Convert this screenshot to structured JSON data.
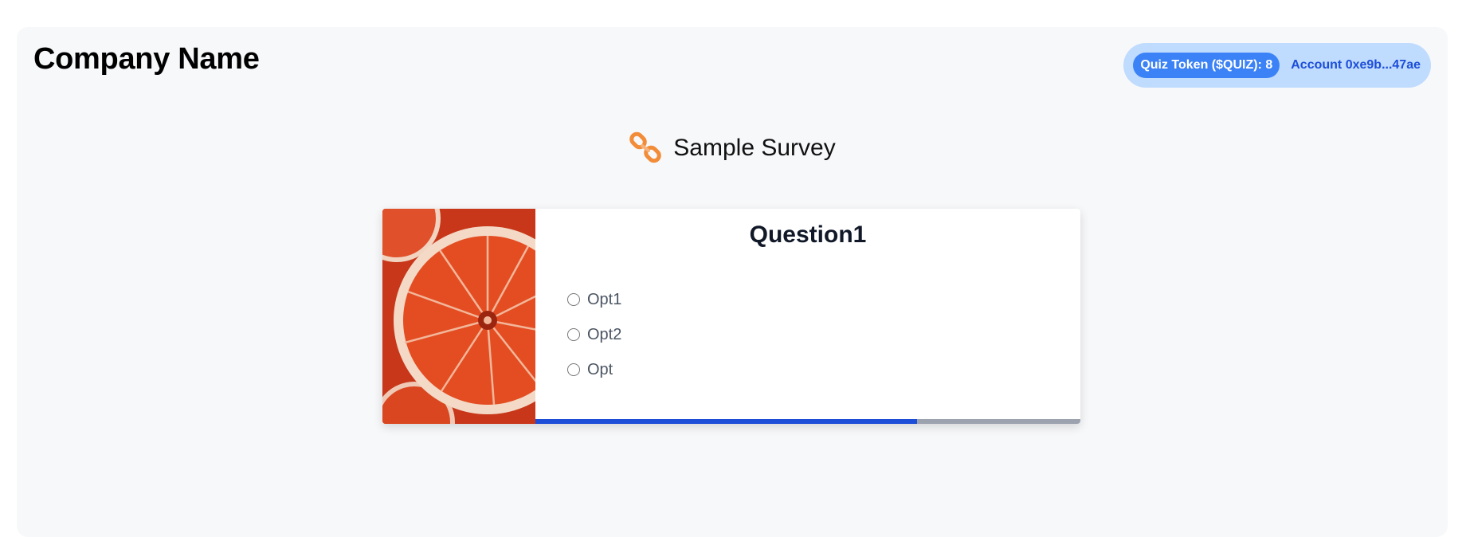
{
  "header": {
    "company_name": "Company Name",
    "token_badge": "Quiz Token ($QUIZ): 8",
    "account": "Account 0xe9b...47ae"
  },
  "survey": {
    "title": "Sample Survey",
    "icon": "chain-link-icon",
    "icon_color": "#f28c38"
  },
  "question": {
    "title": "Question1",
    "image": "orange-slice-image",
    "options": [
      {
        "label": "Opt1"
      },
      {
        "label": "Opt2"
      },
      {
        "label": "Opt"
      }
    ],
    "progress": 0.7
  },
  "colors": {
    "accent": "#3b82f6",
    "pill_bg": "#bfdbfe",
    "account_text": "#1d4ed8",
    "progress_fill": "#1d4ed8",
    "progress_track": "#9ca3af"
  }
}
